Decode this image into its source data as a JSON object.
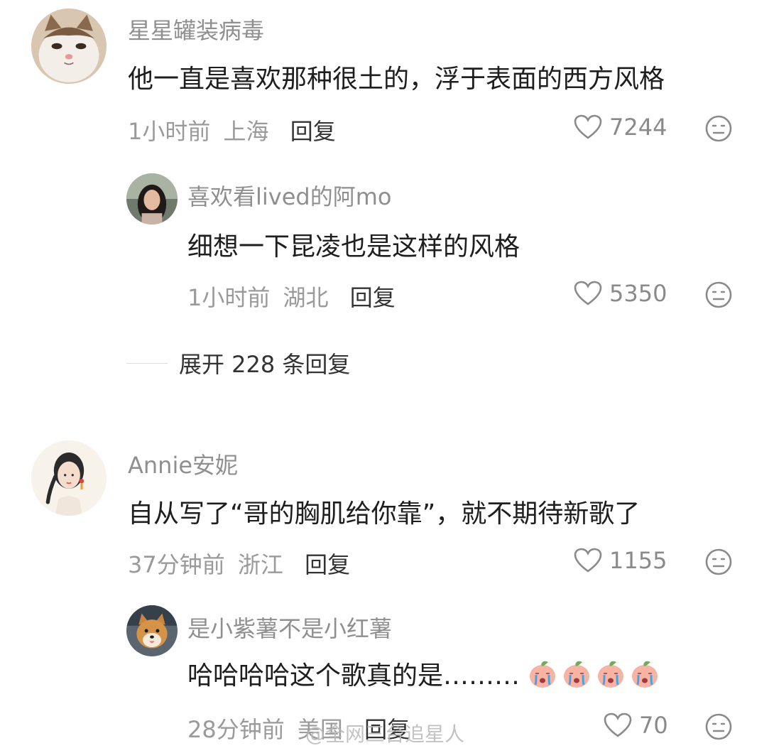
{
  "comments": [
    {
      "username": "星星罐装病毒",
      "text": "他一直是喜欢那种很土的，浮于表面的西方风格",
      "time": "1小时前",
      "location": "上海",
      "reply_label": "回复",
      "likes": "7244",
      "avatar": "cat-avatar",
      "replies": [
        {
          "username": "喜欢看lived的阿mo",
          "text": "细想一下昆凌也是这样的风格",
          "time": "1小时前",
          "location": "湖北",
          "reply_label": "回复",
          "likes": "5350",
          "avatar": "woman-photo-avatar"
        }
      ],
      "expand_label": "展开 228 条回复"
    },
    {
      "username": "Annie安妮",
      "text": "自从写了“哥的胸肌给你靠”，就不期待新歌了",
      "time": "37分钟前",
      "location": "浙江",
      "reply_label": "回复",
      "likes": "1155",
      "avatar": "illustrated-woman-avatar",
      "replies": [
        {
          "username": "是小紫薯不是小红薯",
          "text": "哈哈哈哈这个歌真的是………",
          "emojis": [
            "crying-peach-emoji",
            "crying-peach-emoji",
            "crying-peach-emoji",
            "crying-peach-emoji"
          ],
          "time": "28分钟前",
          "location": "美国",
          "reply_label": "回复",
          "likes": "70",
          "avatar": "shiba-dog-avatar"
        }
      ]
    }
  ],
  "watermark": "@全网三台追星人",
  "icons": {
    "like": "heart-outline-icon",
    "dislike": "meh-face-icon"
  },
  "colors": {
    "username": "#8f8f8f",
    "text": "#1e1e1e",
    "meta": "#9a9a9a",
    "reply": "#333333"
  }
}
